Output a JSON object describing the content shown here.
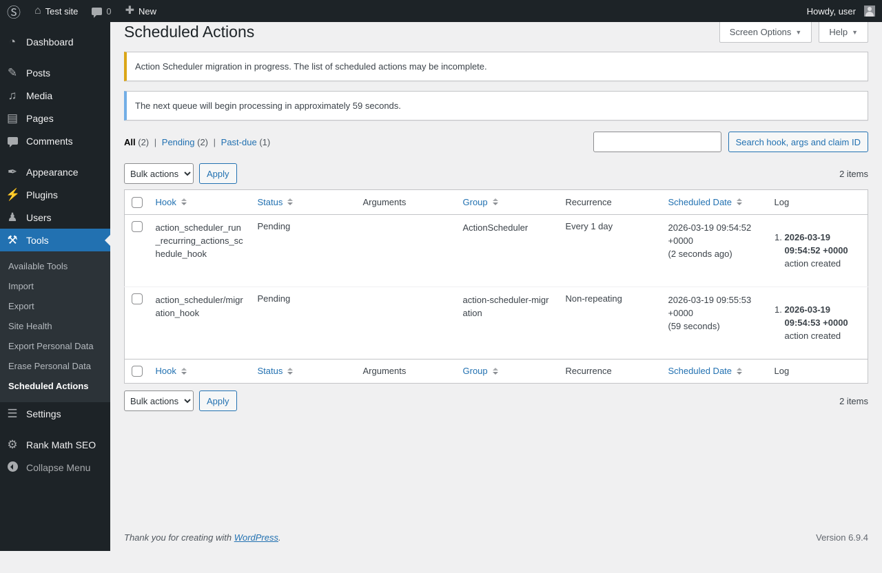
{
  "colors": {
    "accent": "#2271b1",
    "warning": "#dba617",
    "info": "#72aee6",
    "dark": "#1d2327"
  },
  "admin_bar": {
    "site_name": "Test site",
    "comments_count": "0",
    "new_label": "New",
    "howdy": "Howdy, user"
  },
  "sidebar": {
    "items": {
      "dashboard": "Dashboard",
      "posts": "Posts",
      "media": "Media",
      "pages": "Pages",
      "comments": "Comments",
      "appearance": "Appearance",
      "plugins": "Plugins",
      "users": "Users",
      "tools": "Tools",
      "settings": "Settings",
      "rank_math": "Rank Math SEO",
      "collapse": "Collapse Menu"
    },
    "tools_submenu": [
      "Available Tools",
      "Import",
      "Export",
      "Site Health",
      "Export Personal Data",
      "Erase Personal Data",
      "Scheduled Actions"
    ]
  },
  "page": {
    "title": "Scheduled Actions",
    "screen_options_label": "Screen Options",
    "help_label": "Help"
  },
  "notices": [
    {
      "type": "warning",
      "text": "Action Scheduler migration in progress. The list of scheduled actions may be incomplete."
    },
    {
      "type": "info",
      "text": "The next queue will begin processing in approximately 59 seconds."
    }
  ],
  "filters": [
    {
      "label": "All",
      "count": "(2)"
    },
    {
      "label": "Pending",
      "count": "(2)"
    },
    {
      "label": "Past-due",
      "count": "(1)"
    }
  ],
  "search": {
    "button_label": "Search hook, args and claim ID"
  },
  "bulk_actions": {
    "label": "Bulk actions",
    "apply_label": "Apply"
  },
  "counts": {
    "top": "2 items",
    "bottom": "2 items"
  },
  "table": {
    "columns": [
      {
        "label": "Hook",
        "sortable": true
      },
      {
        "label": "Status",
        "sortable": true
      },
      {
        "label": "Arguments",
        "sortable": false
      },
      {
        "label": "Group",
        "sortable": true
      },
      {
        "label": "Recurrence",
        "sortable": false
      },
      {
        "label": "Scheduled Date",
        "sortable": true
      },
      {
        "label": "Log",
        "sortable": false
      }
    ],
    "rows": [
      {
        "hook": "action_scheduler_run_recurring_actions_schedule_hook",
        "status": "Pending",
        "arguments": "",
        "group": "ActionScheduler",
        "recurrence": "Every 1 day",
        "scheduled_date": "2026-03-19 09:54:52 +0000",
        "scheduled_relative": "(2 seconds ago)",
        "log_date": "2026-03-19 09:54:52 +0000",
        "log_message": "action created"
      },
      {
        "hook": "action_scheduler/migration_hook",
        "status": "Pending",
        "arguments": "",
        "group": "action-scheduler-migration",
        "recurrence": "Non-repeating",
        "scheduled_date": "2026-03-19 09:55:53 +0000",
        "scheduled_relative": "(59 seconds)",
        "log_date": "2026-03-19 09:54:53 +0000",
        "log_message": "action created"
      }
    ]
  },
  "footer": {
    "thanks_prefix": "Thank you for creating with ",
    "wordpress_link": "WordPress",
    "thanks_suffix": ".",
    "version": "Version 6.9.4"
  }
}
